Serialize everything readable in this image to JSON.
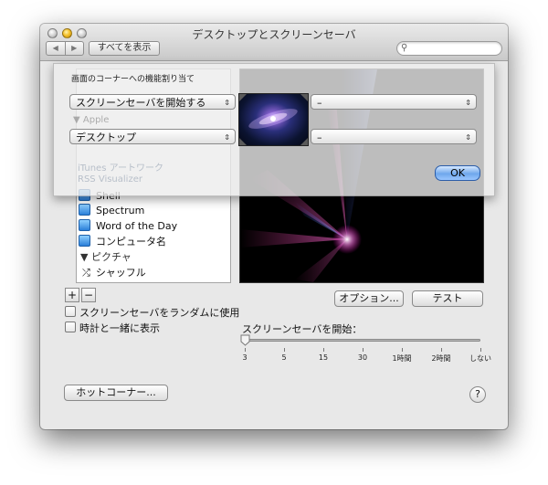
{
  "window": {
    "title": "デスクトップとスクリーンセーバ",
    "back_label": "◀",
    "forward_label": "▶",
    "show_all_label": "すべてを表示",
    "search_placeholder": ""
  },
  "sheet": {
    "title": "画面のコーナーへの機能割り当て",
    "top_left": "スクリーンセーバを開始する",
    "bottom_left": "デスクトップ",
    "top_right": "–",
    "bottom_right": "–",
    "ok_label": "OK",
    "apple_group_label": "Apple",
    "itunes_label": "iTunes アートワーク",
    "rss_label": "RSS Visualizer",
    "dropdown_arrow": "⇕"
  },
  "list": {
    "items": [
      {
        "label": "Shell",
        "icon": "screensaver-icon"
      },
      {
        "label": "Spectrum",
        "icon": "screensaver-icon"
      },
      {
        "label": "Word of the Day",
        "icon": "screensaver-icon"
      },
      {
        "label": "コンピュータ名",
        "icon": "screensaver-icon"
      }
    ],
    "group_pictures": "ピクチャ",
    "shuffle_label": "シャッフル"
  },
  "buttons": {
    "add": "+",
    "remove": "−",
    "options": "オプション...",
    "test": "テスト",
    "hot_corners": "ホットコーナー...",
    "help": "?"
  },
  "checkboxes": {
    "random": "スクリーンセーバをランダムに使用",
    "show_clock": "時計と一緒に表示"
  },
  "start": {
    "label": "スクリーンセーバを開始：",
    "ticks": [
      "3",
      "5",
      "15",
      "30",
      "1時間",
      "2時間",
      "しない"
    ],
    "value_fraction": 0.0
  }
}
